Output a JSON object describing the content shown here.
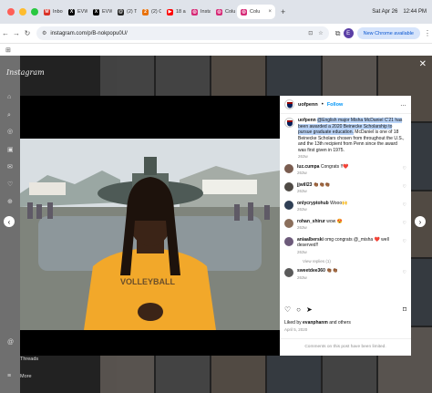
{
  "browser": {
    "tabs": [
      {
        "label": "Inbo",
        "icon": "gmail-icon",
        "color": "#d93025",
        "glyph": "M"
      },
      {
        "label": "EVW",
        "icon": "x-icon",
        "color": "#000000",
        "glyph": "X"
      },
      {
        "label": "EVW",
        "icon": "x-icon",
        "color": "#000000",
        "glyph": "X"
      },
      {
        "label": "(2) T",
        "icon": "threads-icon",
        "color": "#222222",
        "glyph": "@"
      },
      {
        "label": "(2) C",
        "icon": "app-icon",
        "color": "#e8710a",
        "glyph": "2"
      },
      {
        "label": "18 a",
        "icon": "youtube-icon",
        "color": "#ff0000",
        "glyph": "▶"
      },
      {
        "label": "Insta",
        "icon": "instagram-icon",
        "color": "#d62976",
        "glyph": "◎"
      },
      {
        "label": "Colu",
        "icon": "instagram-icon",
        "color": "#d62976",
        "glyph": "◎"
      },
      {
        "label": "Colu",
        "icon": "instagram-icon",
        "color": "#d62976",
        "glyph": "◎",
        "active": true
      }
    ],
    "system": {
      "date": "Sat Apr 26",
      "time": "12:44 PM"
    },
    "address": "instagram.com/p/B-nokpopu0U/",
    "profile_initial": "E",
    "update_label": "New Chrome available"
  },
  "sidebar": {
    "logo": "Instagram",
    "threads_label": "Threads",
    "more_label": "More"
  },
  "post": {
    "author": "uofpenn",
    "follow_label": "Follow",
    "caption_user": "uofpenn",
    "caption_highlight": "English major Misha McDaniel C'21 has been awarded a 2020 Beinecke Scholarship to pursue graduate education.",
    "caption_rest": " McDaniel is one of 18 Beinecke Scholars chosen from throughout the U.S., and the 13th recipient from Penn since the award was first given in 1975.",
    "caption_time": "263w",
    "comments": [
      {
        "user": "luz.cumpa",
        "text": " Congrats !!❤️",
        "time": "263w"
      },
      {
        "user": "jjwill23",
        "text": " 👏🏾👏🏾👏🏾",
        "time": "263w"
      },
      {
        "user": "onlycryptohub",
        "text": " Wooo🙌",
        "time": "263w"
      },
      {
        "user": "rohan_shirur",
        "text": " wow 😍",
        "time": "263w"
      },
      {
        "user": "aniaalberski",
        "text": " omg congrats @_misha ❤️ well deserved!!",
        "time": "263w"
      },
      {
        "user": "sweetdee360",
        "text": " 👏🏾👏🏾",
        "time": "263w"
      }
    ],
    "view_replies": "View replies (1)",
    "likes_prefix": "Liked by ",
    "likes_user": "evanphanm",
    "likes_suffix": " and others",
    "date": "April 5, 2020",
    "limited_note": "Comments on this post have been limited."
  }
}
